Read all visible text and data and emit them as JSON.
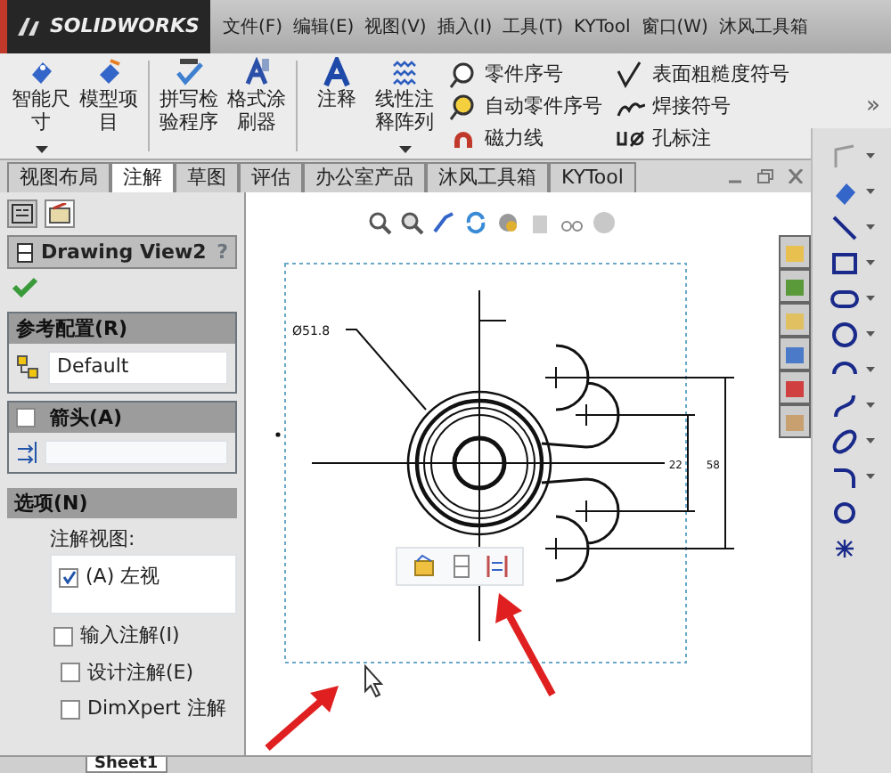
{
  "app": {
    "logo": "SOLIDWORKS"
  },
  "menu": [
    "文件(F)",
    "编辑(E)",
    "视图(V)",
    "插入(I)",
    "工具(T)",
    "KYTool",
    "窗口(W)",
    "沐风工具箱"
  ],
  "ribbon": {
    "large": [
      {
        "label": "智能尺寸",
        "kind": "dimension",
        "dropdown": true
      },
      {
        "label": "模型项目",
        "kind": "model",
        "dropdown": false
      },
      {
        "label": "拼写检验程序",
        "kind": "spell",
        "dropdown": false
      },
      {
        "label": "格式涂刷器",
        "kind": "brush",
        "dropdown": false
      },
      {
        "label": "注释",
        "kind": "note",
        "dropdown": false
      },
      {
        "label": "线性注释阵列",
        "kind": "pattern",
        "dropdown": true
      }
    ],
    "small": [
      {
        "label": "零件序号",
        "kind": "balloon"
      },
      {
        "label": "自动零件序号",
        "kind": "autoballoon"
      },
      {
        "label": "磁力线",
        "kind": "magnet"
      },
      {
        "label": "表面粗糙度符号",
        "kind": "surface"
      },
      {
        "label": "焊接符号",
        "kind": "weld"
      },
      {
        "label": "孔标注",
        "kind": "hole"
      }
    ],
    "more": "»"
  },
  "tabs": [
    {
      "label": "视图布局",
      "selected": false
    },
    {
      "label": "注解",
      "selected": true
    },
    {
      "label": "草图",
      "selected": false
    },
    {
      "label": "评估",
      "selected": false
    },
    {
      "label": "办公室产品",
      "selected": false
    },
    {
      "label": "沐风工具箱",
      "selected": false
    },
    {
      "label": "KYTool",
      "selected": false
    }
  ],
  "panel": {
    "tabs": [
      {
        "kind": "tree",
        "selected": false
      },
      {
        "kind": "property",
        "selected": true
      }
    ],
    "title": "Drawing View2",
    "help": "?",
    "config": {
      "title": "参考配置(R)",
      "value": "Default"
    },
    "arrow": {
      "title": "箭头(A)",
      "checked": false
    },
    "options": {
      "title": "选项(N)",
      "list_label": "注解视图:",
      "views": [
        {
          "label": "(A) 左视",
          "checked": true
        }
      ],
      "checkboxes": [
        {
          "label": "输入注解(I)",
          "checked": false
        },
        {
          "label": "设计注解(E)",
          "checked": false
        },
        {
          "label": "DimXpert 注解",
          "checked": false
        }
      ]
    }
  },
  "drawing": {
    "diameter": "Ø51.8",
    "dim_inner": "22",
    "dim_outer": "58"
  },
  "sheets": [
    {
      "label": "Sheet1",
      "selected": true
    }
  ]
}
